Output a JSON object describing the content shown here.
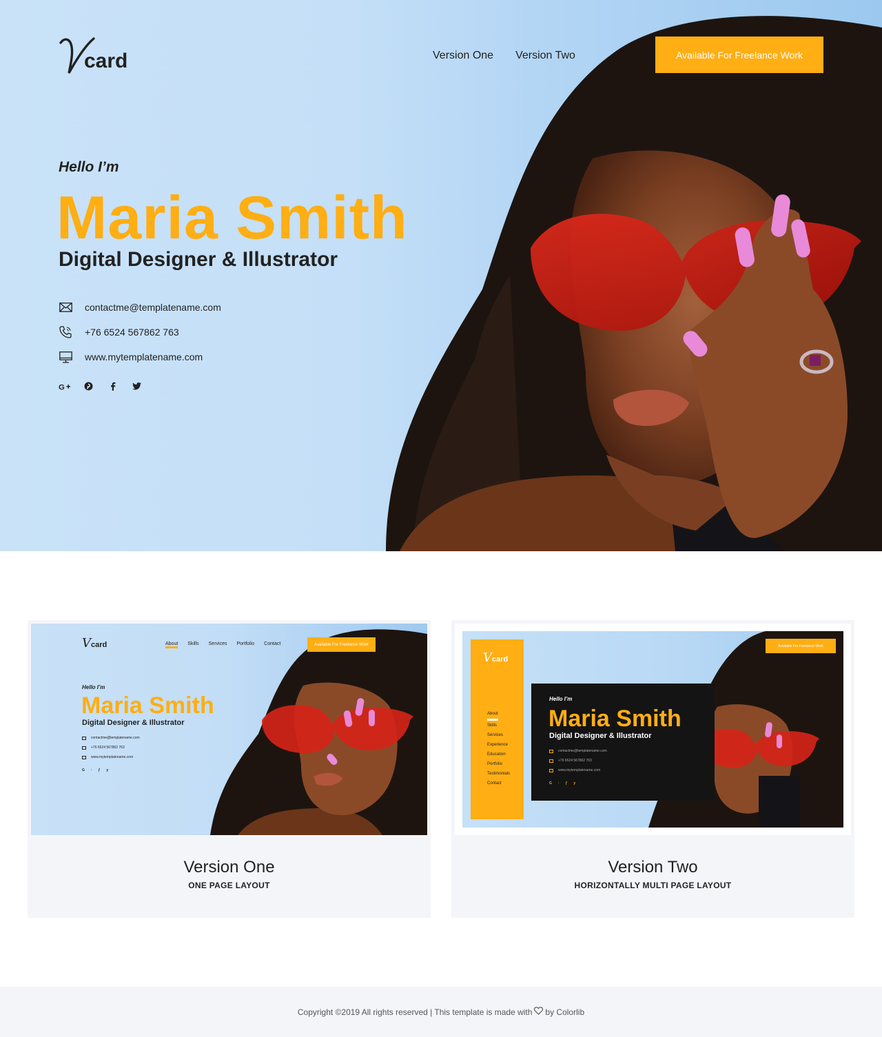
{
  "brand": {
    "logo_v": "V",
    "logo_word": "card",
    "accent": "#ffae13"
  },
  "nav": {
    "items": [
      "Version One",
      "Version Two"
    ],
    "active_index": 0
  },
  "cta_label": "Available For Freelance Work",
  "hero": {
    "greeting": "Hello I’m",
    "name": "Maria Smith",
    "role": "Digital Designer & Illustrator",
    "contacts": [
      {
        "icon": "envelope-icon",
        "text": "contactme@templatename.com"
      },
      {
        "icon": "phone-icon",
        "text": "+76 6524 567862 763"
      },
      {
        "icon": "monitor-icon",
        "text": "www.mytemplatename.com"
      }
    ],
    "socials": [
      "google-plus-icon",
      "pinterest-icon",
      "facebook-icon",
      "twitter-icon"
    ]
  },
  "versions": [
    {
      "title": "Version One",
      "subtitle": "ONE PAGE LAYOUT",
      "preview": {
        "nav": [
          "About",
          "Skills",
          "Services",
          "Portfolio",
          "Contact"
        ],
        "cta": "Available For Freelance Work",
        "greeting": "Hello I’m",
        "name": "Maria Smith",
        "role": "Digital Designer & Illustrator",
        "contacts": [
          "contactme@templatename.com",
          "+76 6524 567862 763",
          "www.mytemplatename.com"
        ]
      }
    },
    {
      "title": "Version Two",
      "subtitle": "HORIZONTALLY MULTI PAGE LAYOUT",
      "preview": {
        "menu": [
          "About",
          "Skills",
          "Services",
          "Experience",
          "Education",
          "Portfolio",
          "Testimonials",
          "Contact"
        ],
        "cta": "Available For Freelance Work",
        "greeting": "Hello I’m",
        "name": "Maria Smith",
        "role": "Digital Designer & Illustrator",
        "contacts": [
          "contactme@templatename.com",
          "+76 6524 567862 763",
          "www.mytemplatename.com"
        ]
      }
    }
  ],
  "footer": {
    "text_before": "Copyright ©2019 All rights reserved | This template is made with",
    "text_after": "by Colorlib"
  }
}
